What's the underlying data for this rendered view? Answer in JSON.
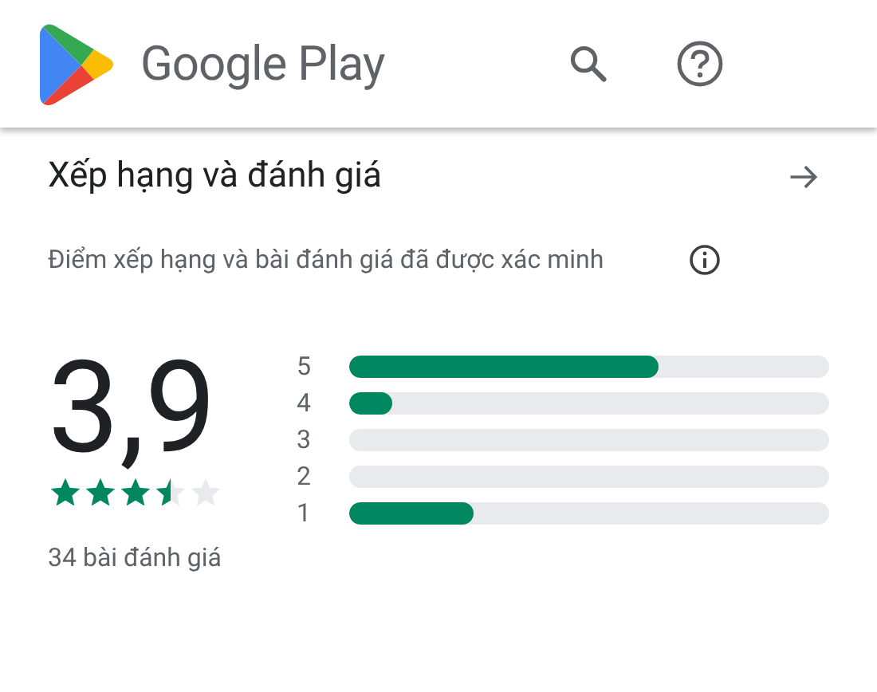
{
  "header": {
    "brand": "Google Play"
  },
  "section": {
    "title": "Xếp hạng và đánh giá",
    "note": "Điểm xếp hạng và bài đánh giá đã được xác minh"
  },
  "summary": {
    "score": "3,9",
    "stars": 3.5,
    "count": "34 bài đánh giá"
  },
  "distribution": [
    {
      "label": "5",
      "level": 0.645
    },
    {
      "label": "4",
      "level": 0.09
    },
    {
      "label": "3",
      "level": 0
    },
    {
      "label": "2",
      "level": 0
    },
    {
      "label": "1",
      "level": 0.26
    }
  ]
}
